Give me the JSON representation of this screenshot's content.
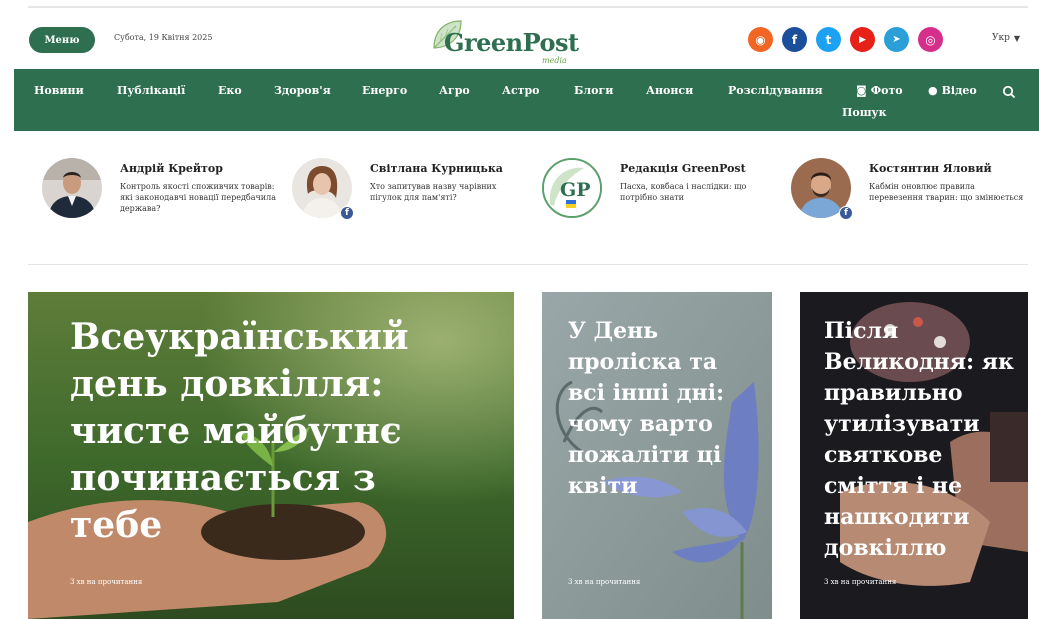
{
  "header": {
    "menu_label": "Меню",
    "date": "Субота, 19 Квітня 2025",
    "logo": {
      "name": "GreenPost",
      "sub": "media"
    },
    "language": "Укр",
    "socials": [
      {
        "icon": "rss-icon",
        "glyph": "◉",
        "color": "#f26522"
      },
      {
        "icon": "facebook-icon",
        "glyph": "f",
        "color": "#1b4f9c"
      },
      {
        "icon": "twitter-icon",
        "glyph": "t",
        "color": "#1da1f2"
      },
      {
        "icon": "youtube-icon",
        "glyph": "▶",
        "color": "#e62117"
      },
      {
        "icon": "telegram-icon",
        "glyph": "➤",
        "color": "#2a9fd8"
      },
      {
        "icon": "instagram-icon",
        "glyph": "◎",
        "color": "#d62e8b"
      }
    ]
  },
  "nav": {
    "items": [
      {
        "label": "Новини"
      },
      {
        "label": "Публікації"
      },
      {
        "label": "Еко"
      },
      {
        "label": "Здоров'я"
      },
      {
        "label": "Енерго"
      },
      {
        "label": "Агро"
      },
      {
        "label": "Астро"
      },
      {
        "label": "Блоги"
      },
      {
        "label": "Анонси"
      },
      {
        "label": "Розслідування"
      },
      {
        "label": "Фото"
      },
      {
        "label": "Відео"
      },
      {
        "label": "Пошук"
      }
    ]
  },
  "authors": [
    {
      "name": "Андрій Крейтор",
      "text": "Контроль якості споживчих товарів: які законодавчі новації передбачила держава?"
    },
    {
      "name": "Світлана Курницька",
      "text": "Хто запитував назву чарівних пігулок для пам'яті?"
    },
    {
      "name": "Редакція GreenPost",
      "text": "Пасха, ковбаса і наслідки: що потрібно знати",
      "logo": "GP"
    },
    {
      "name": "Костянтин Яловий",
      "text": "Кабмін оновлює правила перевезення тварин: що змінюється"
    }
  ],
  "cards": [
    {
      "title": "Всеукраїнський день довкілля: чисте майбутнє починається з тебе",
      "meta": "3 хв на прочитання"
    },
    {
      "title": "У День проліска та всі інші дні: чому варто пожаліти ці квіти",
      "meta": "3 хв на прочитання"
    },
    {
      "title": "Після Великодня: як правильно утилізувати святкове сміття і не нашкодити довкіллю",
      "meta": "3 хв на прочитання"
    }
  ]
}
